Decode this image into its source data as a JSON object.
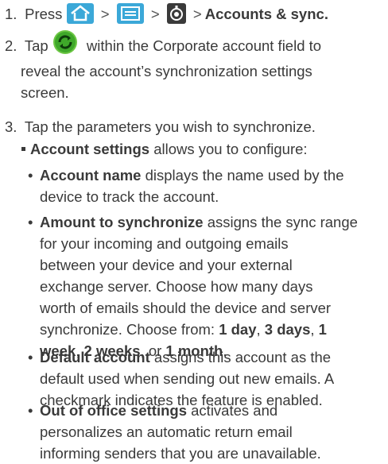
{
  "step1": {
    "num": "1.",
    "press": "Press",
    "sep": ">",
    "target": "Accounts & sync.",
    "icons": [
      "home-icon",
      "menu-icon",
      "settings-icon"
    ]
  },
  "step2": {
    "num": "2.",
    "tap": "Tap",
    "text_line1": "within the Corporate account field to",
    "text_line2": "reveal the account’s synchronization settings",
    "text_line3": "screen.",
    "icon": "sync-icon"
  },
  "step3": {
    "num": "3.",
    "text": "Tap the parameters you wish to synchronize."
  },
  "account_settings": {
    "label": "Account settings",
    "text": " allows you to configure:"
  },
  "bullets": {
    "account_name": {
      "label": "Account name",
      "line1": " displays the name used by the",
      "line2": "device to track the account."
    },
    "amount": {
      "label": "Amount to synchronize",
      "line1": " assigns the sync range",
      "line2": "for your incoming and outgoing emails",
      "line3": "between your device and your external",
      "line4": "exchange server. Choose how many days",
      "line5": "worth of emails should the device and server",
      "line6_prefix": "synchronize. Choose from: ",
      "opt1": "1 day",
      "opt2": "3 days",
      "opt3a": "1",
      "opt3b": "week",
      "opt4": "2 weeks",
      "or": "or",
      "opt5": "1 month"
    },
    "default_account": {
      "label": "Default account",
      "line1": " assigns this account as the",
      "line2": "default used when sending out new emails. A",
      "line3": "checkmark indicates the feature is enabled."
    },
    "out_of_office": {
      "label": "Out of office settings",
      "line1": " activates and",
      "line2": "personalizes an automatic return email",
      "line3": "informing senders that you are unavailable."
    }
  }
}
